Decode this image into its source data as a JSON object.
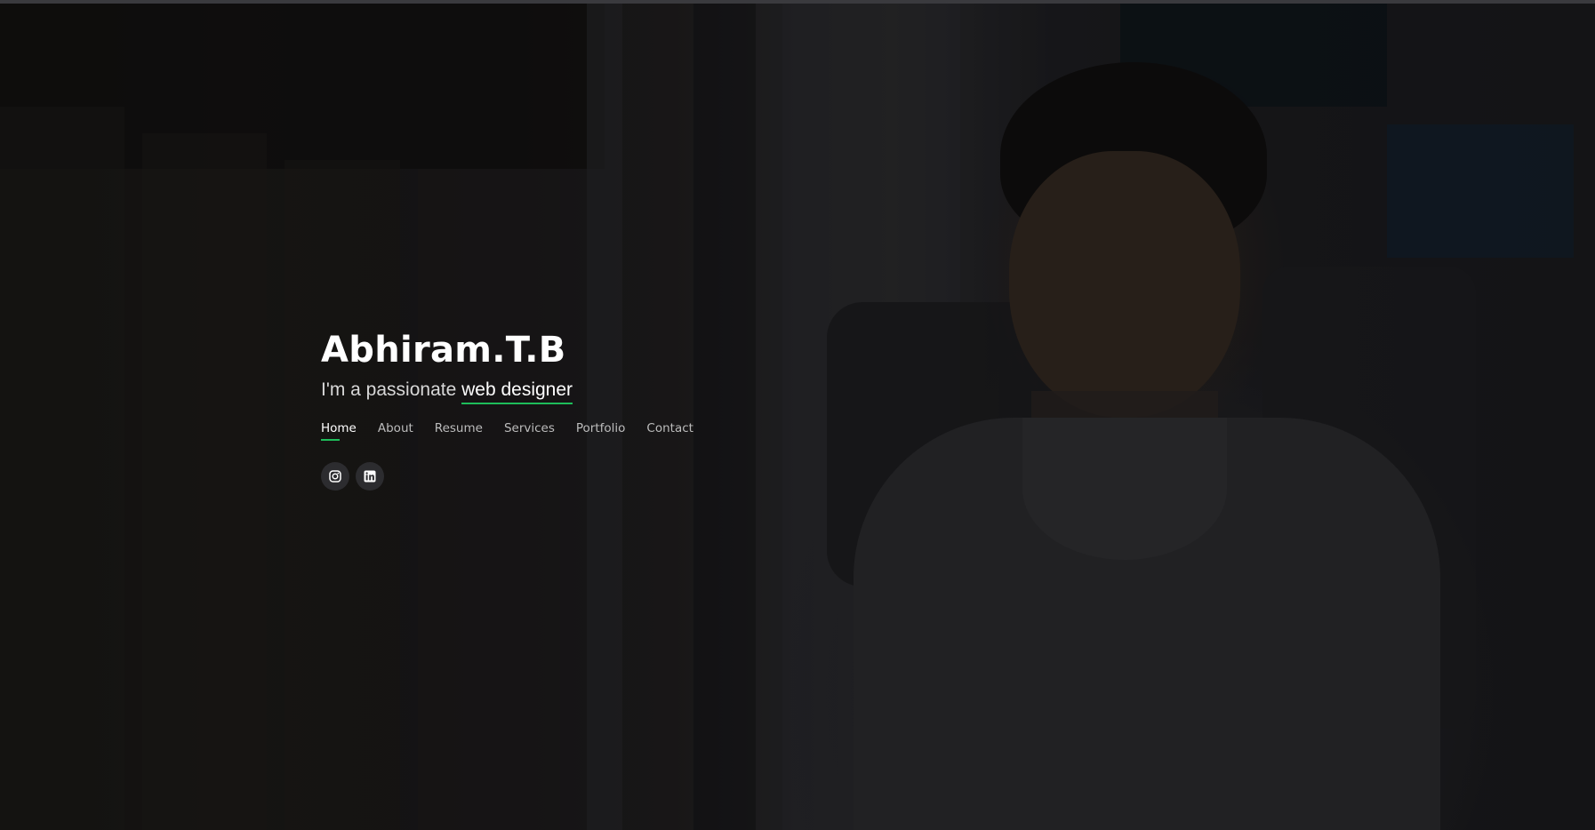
{
  "hero": {
    "name": "Abhiram.T.B",
    "subtitle_prefix": "I'm a passionate ",
    "subtitle_highlight": "web designer"
  },
  "nav": {
    "items": [
      {
        "label": "Home",
        "active": true
      },
      {
        "label": "About",
        "active": false
      },
      {
        "label": "Resume",
        "active": false
      },
      {
        "label": "Services",
        "active": false
      },
      {
        "label": "Portfolio",
        "active": false
      },
      {
        "label": "Contact",
        "active": false
      }
    ]
  },
  "social": {
    "links": [
      {
        "icon": "instagram-icon"
      },
      {
        "icon": "linkedin-icon"
      }
    ]
  },
  "colors": {
    "accent": "#1ebd5a",
    "text": "#ffffff",
    "nav_text": "#bcbcbc",
    "social_bg": "#2c2c2f"
  }
}
